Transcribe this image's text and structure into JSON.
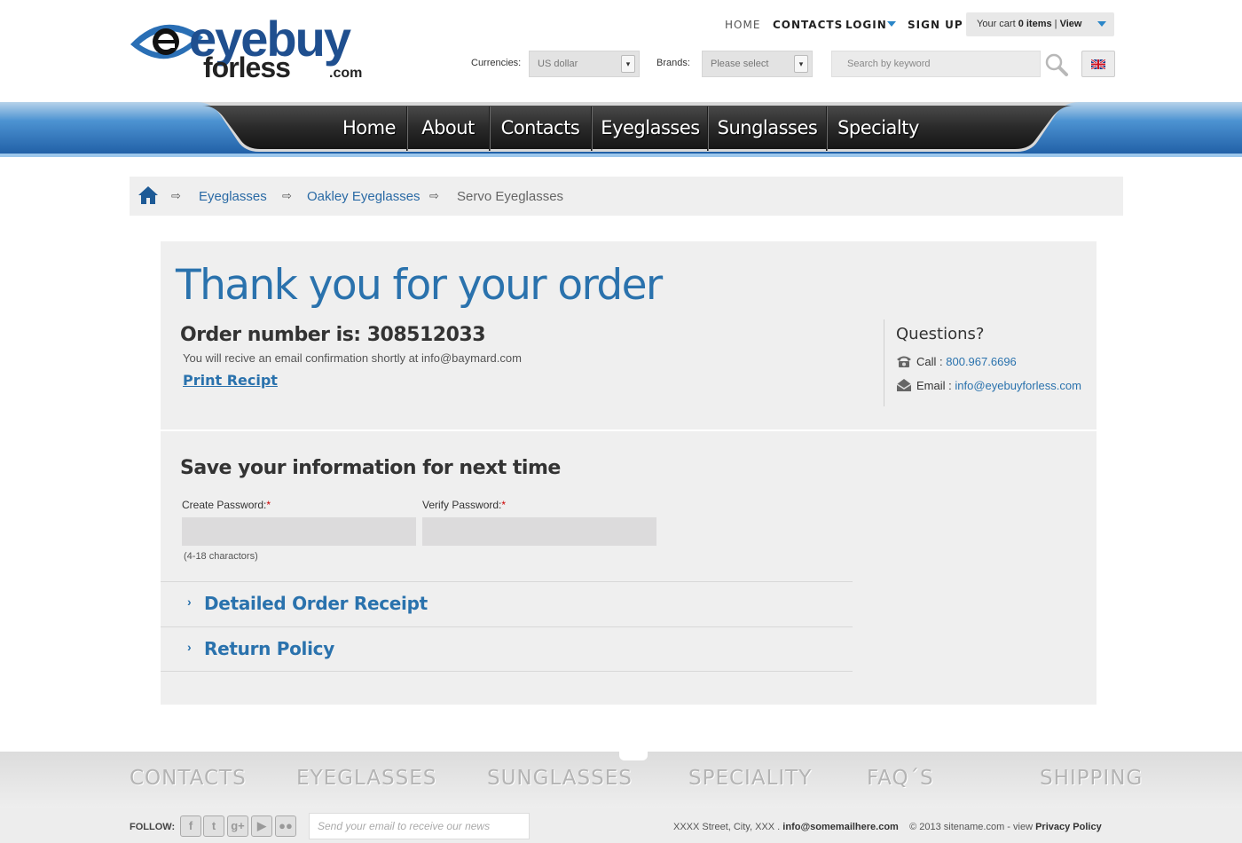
{
  "brand": {
    "logo_main": "eyebuy",
    "logo_sub": "forless",
    "logo_com": ".com"
  },
  "topnav": {
    "home": "HOME",
    "contacts": "CONTACTS",
    "login": "LOGIN",
    "signup": "SIGN UP"
  },
  "cart": {
    "prefix": "Your cart",
    "items": "0 items",
    "sep": "|",
    "view": "View"
  },
  "filters": {
    "currencies_label": "Currencies:",
    "currency_value": "US dollar",
    "brands_label": "Brands:",
    "brand_placeholder": "Please select",
    "search_placeholder": "Search by keyword"
  },
  "mainnav": [
    "Home",
    "About",
    "Contacts",
    "Eyeglasses",
    "Sunglasses",
    "Specialty"
  ],
  "breadcrumb": {
    "items": [
      "Eyeglasses",
      "Oakley Eyeglasses"
    ],
    "current": "Servo Eyeglasses",
    "arrow": "⇨"
  },
  "order": {
    "title": "Thank you for your order",
    "number_label": "Order number is: 308512033",
    "confirmation": "You will recive an email confirmation shortly at info@baymard.com",
    "print_label": "Print Recipt"
  },
  "questions": {
    "title": "Questions?",
    "call_label": "Call :",
    "call_value": "800.967.6696",
    "email_label": "Email :",
    "email_value": "info@eyebuyforless.com"
  },
  "save": {
    "title": "Save your information for next time",
    "create_label": "Create Password:",
    "verify_label": "Verify Password:",
    "required_mark": "*",
    "hint": "(4-18 charactors)"
  },
  "accordion": {
    "chevron": "›",
    "items": [
      "Detailed Order Receipt",
      "Return Policy"
    ]
  },
  "footer": {
    "links": [
      "CONTACTS",
      "EYEGLASSES",
      "SUNGLASSES",
      "SPECIALITY",
      "FAQ´S",
      "SHIPPING"
    ],
    "follow": "FOLLOW:",
    "newsletter_placeholder": "Send your email to receive our news",
    "address": "XXXX Street, City, XXX .",
    "email": "info@somemailhere.com",
    "copyright": "© 2013 sitename.com - view",
    "privacy": "Privacy Policy"
  },
  "colors": {
    "accent": "#2a72ad",
    "nav_bg": "#2b2b2b",
    "nav_blue": "#2e7ec4",
    "panel_bg": "#efefef"
  }
}
